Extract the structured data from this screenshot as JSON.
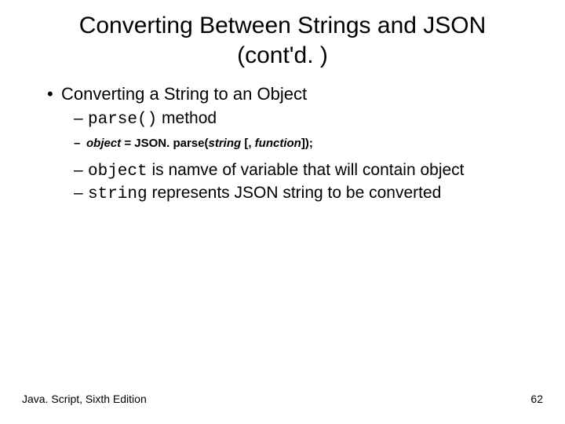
{
  "title_line1": "Converting Between Strings and JSON",
  "title_line2": "(cont'd. )",
  "lvl1_text": "Converting a String to an Object",
  "sub1_code": "parse()",
  "sub1_rest": " method",
  "syntax_obj": "object",
  "syntax_mid1": " = JSON. parse(",
  "syntax_string": "string",
  "syntax_mid2": " [, ",
  "syntax_func": "function",
  "syntax_end": "]);",
  "sub3_code": "object",
  "sub3_rest": " is namve of variable that will contain object",
  "sub4_code": "string",
  "sub4_rest": " represents JSON string to be converted",
  "footer_left": "Java. Script, Sixth Edition",
  "footer_right": "62"
}
